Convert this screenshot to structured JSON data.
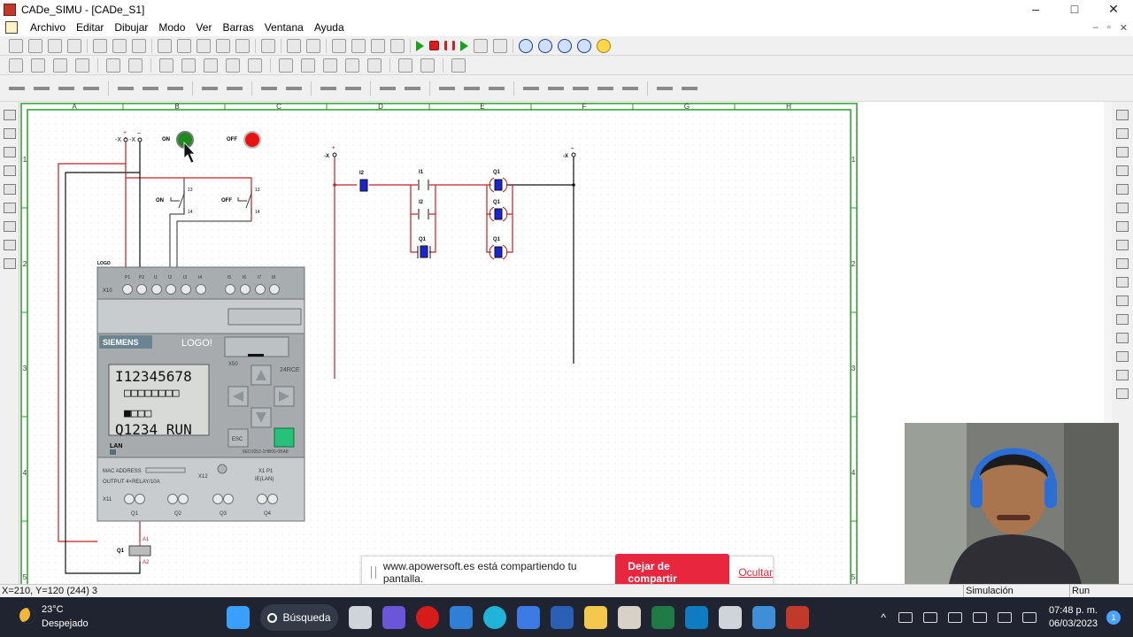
{
  "window": {
    "title": "CADe_SIMU - [CADe_S1]",
    "controls": [
      "–",
      "□",
      "✕"
    ]
  },
  "menu": [
    "Archivo",
    "Editar",
    "Dibujar",
    "Modo",
    "Ver",
    "Barras",
    "Ventana",
    "Ayuda"
  ],
  "mdi_controls": [
    "–",
    "▫",
    "✕"
  ],
  "schematic": {
    "columns": [
      "A",
      "B",
      "C",
      "D",
      "E",
      "F",
      "G",
      "H"
    ],
    "rows": [
      "1",
      "2",
      "3",
      "4",
      "5"
    ],
    "supply_left": {
      "pos": "+",
      "neg": "–",
      "pos_terminal": "-X",
      "neg_terminal": "-X"
    },
    "pushbuttons": {
      "on_label": "ON",
      "off_label": "OFF",
      "contact_no": "13",
      "contact_nc": "14"
    },
    "plc": {
      "logo_tag": "LOGO",
      "brand": "SIEMENS",
      "model": "LOGO!",
      "input_row_label": "X10",
      "input_terminals": [
        "P1",
        "P2",
        "I1",
        "I2",
        "I3",
        "I4",
        "I5",
        "I6",
        "I7",
        "I8"
      ],
      "display_line1": "I12345678",
      "display_line2": "□□□□□□□□",
      "display_line3": "■□□□",
      "display_line4": "Q1234 RUN",
      "lan": "LAN",
      "x50": "X50",
      "variant": "24RCE",
      "esc": "ESC",
      "order_no": "6ED1052-1HB00-0BA8",
      "mac_label": "MAC ADDRESS",
      "output_label": "OUTPUT 4×RELAY/10A",
      "x12": "X12",
      "x1p1": "X1 P1",
      "ie_lan": "IE(LAN)",
      "output_row_label": "X11",
      "outputs": [
        "Q1",
        "Q2",
        "Q3",
        "Q4"
      ]
    },
    "coil": {
      "name": "Q1",
      "a1": "A1",
      "a2": "A2"
    },
    "ladder": {
      "pos": "+",
      "neg": "–",
      "terminal": "-X",
      "elements": [
        "I2",
        "I1",
        "I2",
        "Q1",
        "Q1",
        "Q1",
        "Q1"
      ]
    }
  },
  "statusbar": {
    "coords": "X=210, Y=120 (244) 3",
    "mode": "Simulación",
    "state": "Run"
  },
  "share": {
    "message": "www.apowersoft.es está compartiendo tu pantalla.",
    "stop": "Dejar de compartir",
    "hide": "Ocultar"
  },
  "taskbar": {
    "temp": "23°C",
    "weather": "Despejado",
    "search": "Búsqueda",
    "time": "07:48 p. m.",
    "date": "06/03/2023",
    "notifications": "1"
  },
  "colors": {
    "accent_red": "#e8263d",
    "wire_red": "#c81e1e",
    "grid_green": "#24a324",
    "plc_gray": "#c9ccce"
  }
}
